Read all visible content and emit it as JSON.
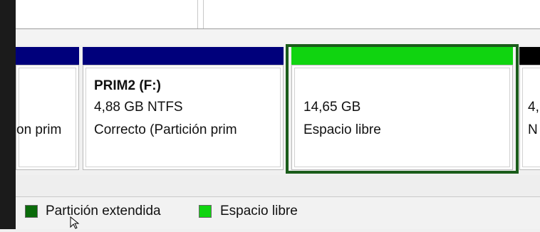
{
  "colors": {
    "primary_header": "#00007b",
    "free_space": "#10d410",
    "extended_partition": "#0a6b0a",
    "unallocated_header": "#000000",
    "selection_border": "#1a5c1a"
  },
  "partitions": [
    {
      "name": "",
      "size": "",
      "status": "on prim"
    },
    {
      "name": "PRIM2  (F:)",
      "size": "4,88 GB NTFS",
      "status": "Correcto (Partición prim"
    },
    {
      "name": "",
      "size": "14,65 GB",
      "status": "Espacio libre"
    },
    {
      "name": "",
      "size": "4,",
      "status": "N"
    }
  ],
  "legend": [
    {
      "label": "Partición extendida",
      "icon": "extended-partition-swatch"
    },
    {
      "label": "Espacio libre",
      "icon": "free-space-swatch"
    }
  ]
}
